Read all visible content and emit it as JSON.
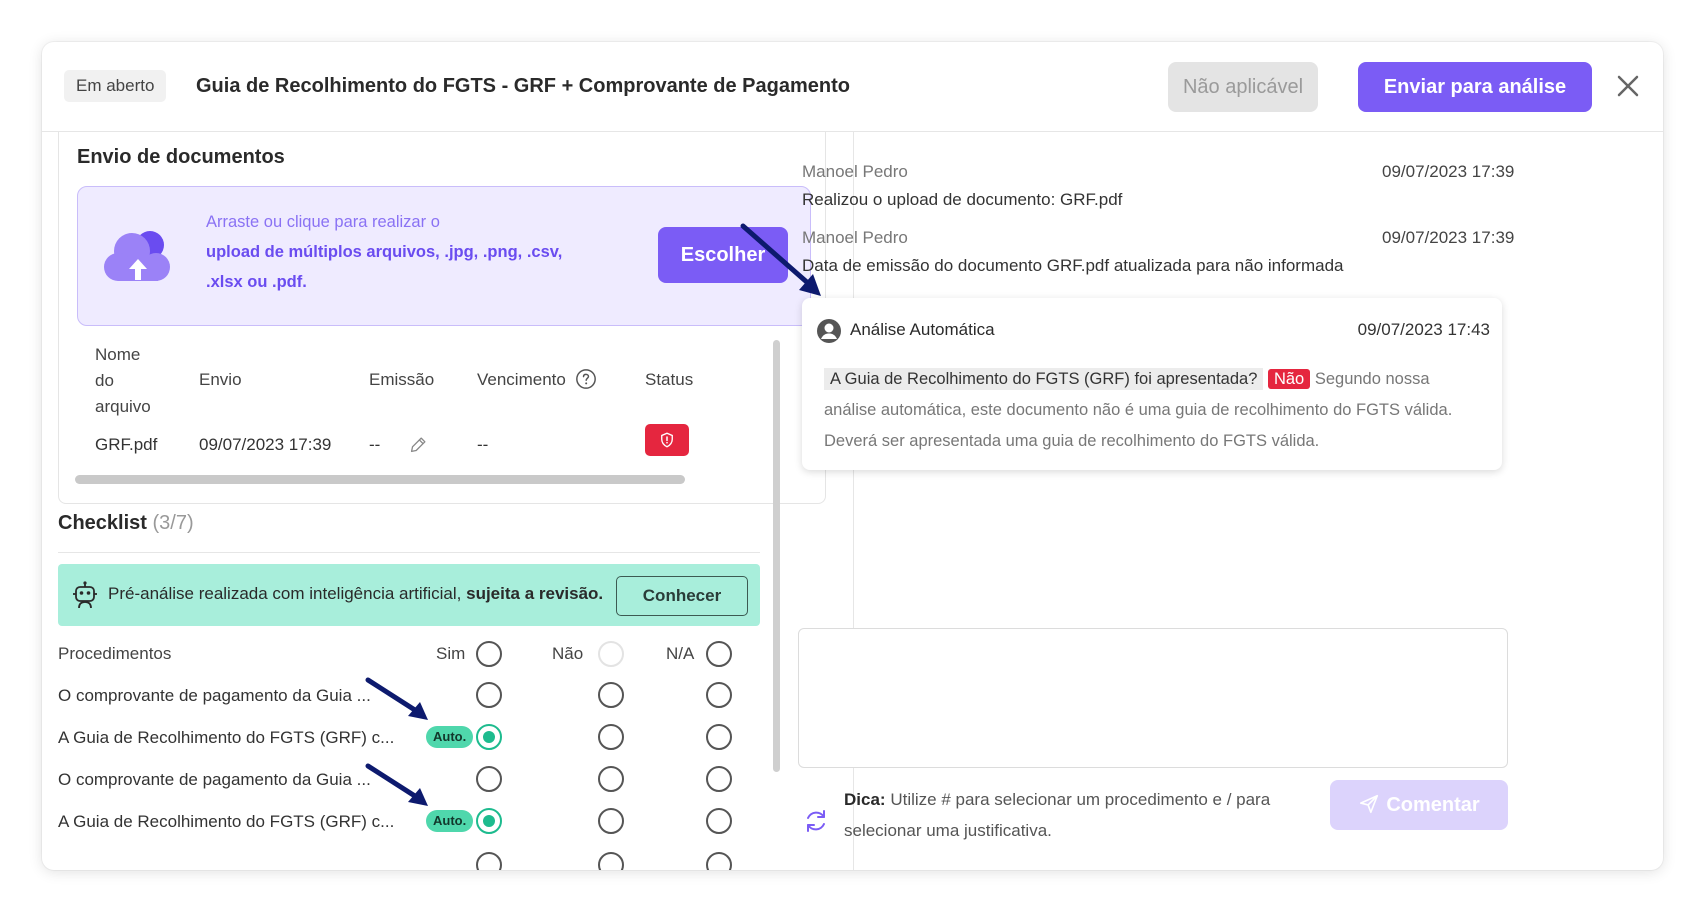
{
  "header": {
    "status": "Em aberto",
    "title": "Guia de Recolhimento do FGTS - GRF + Comprovante de Pagamento",
    "not_applicable_label": "Não aplicável",
    "send_label": "Enviar para análise"
  },
  "upload": {
    "section_title": "Envio de documentos",
    "drop_line1": "Arraste ou clique para realizar o",
    "drop_line2": "upload de múltiplos arquivos, .jpg, .png, .csv,",
    "drop_line3": ".xlsx ou .pdf.",
    "choose_label": "Escolher",
    "columns": {
      "name_l1": "Nome",
      "name_l2": "do",
      "name_l3": "arquivo",
      "sent": "Envio",
      "issue": "Emissão",
      "due": "Vencimento",
      "status": "Status"
    },
    "file": {
      "name": "GRF.pdf",
      "sent": "09/07/2023 17:39",
      "issue": "--",
      "due": "--"
    }
  },
  "checklist": {
    "title": "Checklist",
    "count": "(3/7)",
    "ai_text": "Pré-análise realizada com inteligência artificial,",
    "ai_bold": "sujeita a revisão.",
    "learn_label": "Conhecer",
    "header": "Procedimentos",
    "col_yes": "Sim",
    "col_no": "Não",
    "col_na": "N/A",
    "auto_label": "Auto.",
    "items": [
      "O comprovante de pagamento da Guia ...",
      "A Guia de Recolhimento do FGTS (GRF) c...",
      "O comprovante de pagamento da Guia ...",
      "A Guia de Recolhimento do FGTS (GRF) c..."
    ]
  },
  "activity": [
    {
      "author": "Manoel Pedro",
      "date": "09/07/2023 17:39",
      "message": "Realizou o upload de documento: GRF.pdf"
    },
    {
      "author": "Manoel Pedro",
      "date": "09/07/2023 17:39",
      "message": "Data de emissão do documento GRF.pdf atualizada para não informada"
    }
  ],
  "analysis": {
    "title": "Análise Automática",
    "date": "09/07/2023 17:43",
    "question": "A Guia de Recolhimento do FGTS (GRF) foi apresentada?",
    "answer": "Não",
    "text": "Segundo nossa análise automática, este documento não é uma guia de recolhimento do FGTS válida. Deverá ser apresentada uma guia de recolhimento do FGTS válida."
  },
  "comment": {
    "tip_label": "Dica:",
    "tip_text": "Utilize # para selecionar um procedimento e / para selecionar uma justificativa.",
    "submit_label": "Comentar"
  },
  "colors": {
    "primary": "#7b5cf5",
    "danger": "#e5263f",
    "success": "#1dbb8e",
    "ai_banner": "#a8eedb",
    "annotation_arrow": "#0d1a6e"
  }
}
